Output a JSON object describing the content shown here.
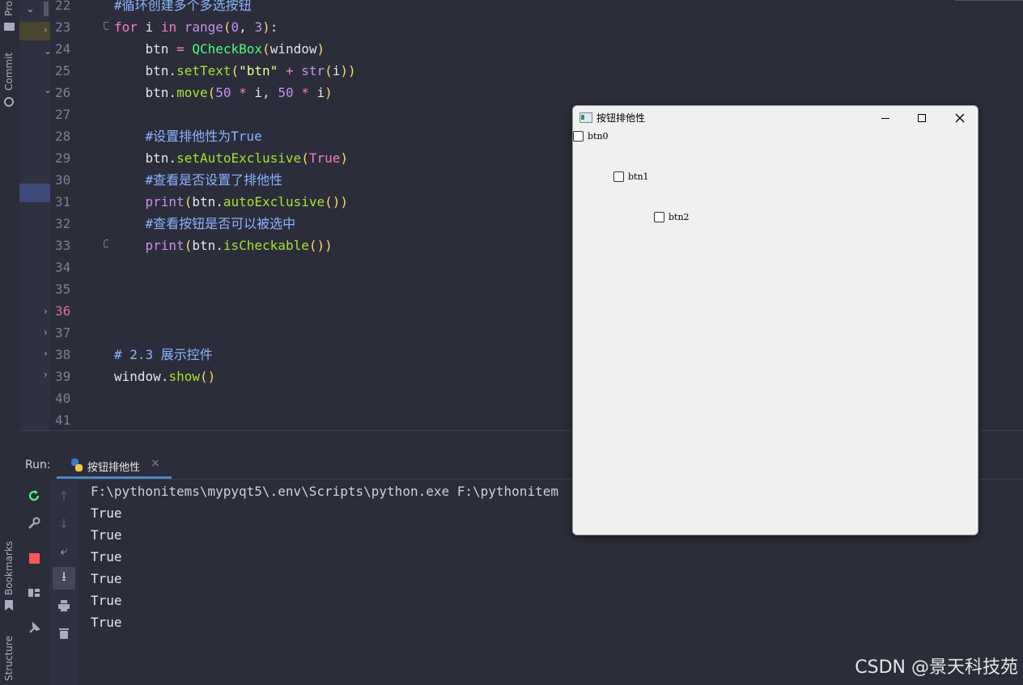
{
  "sidebar_left": {
    "project_label": "Pro",
    "commit_label": "Commit",
    "bookmarks_label": "Bookmarks",
    "structure_label": "Structure"
  },
  "editor": {
    "line_numbers": [
      "22",
      "23",
      "24",
      "25",
      "26",
      "27",
      "28",
      "29",
      "30",
      "31",
      "32",
      "33",
      "34",
      "35",
      "36",
      "37",
      "38",
      "39",
      "40",
      "41"
    ],
    "current_line": "36"
  },
  "run": {
    "label": "Run:",
    "tab_label": "按钮排他性",
    "command": "F:\\pythonitems\\mypyqt5\\.env\\Scripts\\python.exe F:\\pythonitem",
    "output": [
      "True",
      "True",
      "True",
      "True",
      "True",
      "True"
    ]
  },
  "qt_window": {
    "title": "按钮排他性",
    "checkboxes": [
      "btn0",
      "btn1",
      "btn2"
    ]
  },
  "watermark": "CSDN @景天科技苑",
  "colors": {
    "editor_bg": "#2b2d3a",
    "current_line": "#3b3e52",
    "accent_green": "#50fa7b",
    "stop_red": "#ff5555",
    "qt_bg": "#f0f0f0"
  }
}
